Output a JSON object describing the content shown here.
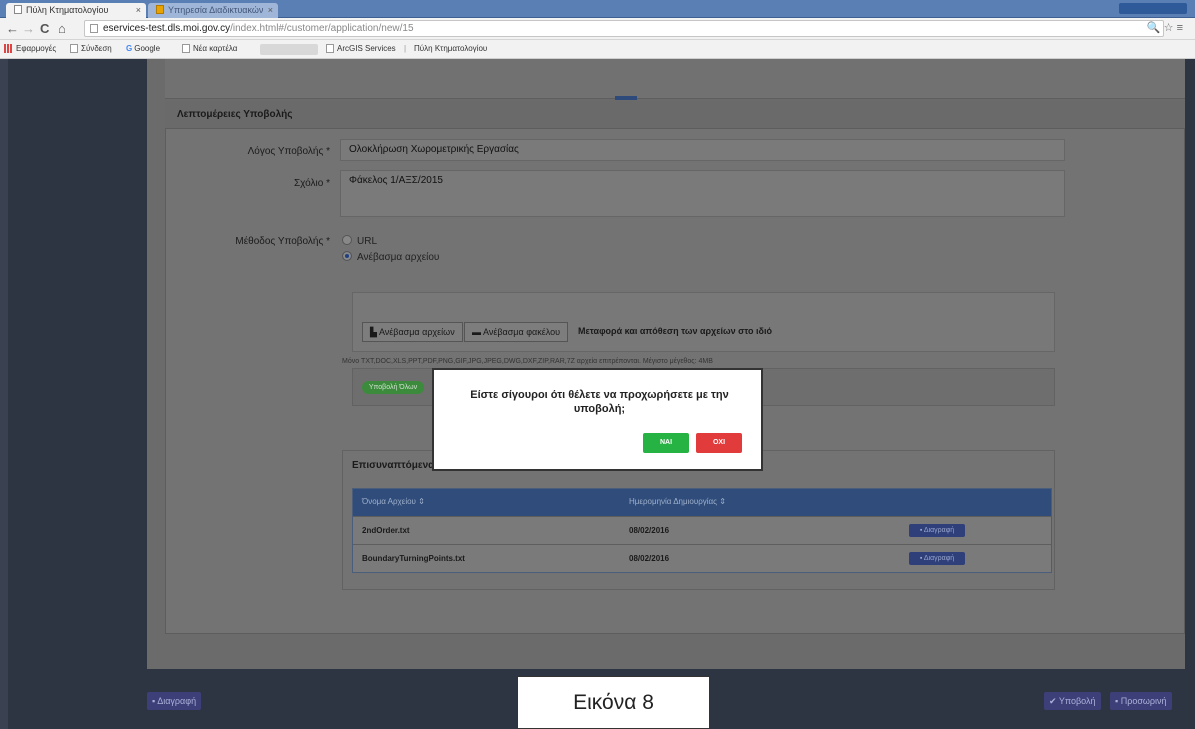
{
  "browser": {
    "tabs": [
      {
        "label": "Πύλη Κτηματολογίου",
        "active": true
      },
      {
        "label": "Υπηρεσία Διαδικτυακών",
        "active": false
      }
    ],
    "close_glyph": "×",
    "nav": {
      "back": "←",
      "forward": "→",
      "reload": "C",
      "home": "⌂"
    },
    "url_host": "eservices-test.dls.moi.gov.cy",
    "url_path": "/index.html#/customer/application/new/15",
    "url_right_icons": "🔍 ☆ ≡",
    "bookmarks": [
      "Εφαρμογές",
      "Σύνδεση",
      "Google",
      "Νέα καρτέλα",
      "ArcGIS Services",
      "Πύλη Κτηματολογίου"
    ],
    "bookmark_separator": "|"
  },
  "form": {
    "panel_title": "Λεπτομέρειες Υποβολής",
    "reason_label": "Λόγος Υποβολής",
    "reason_value": "Ολοκλήρωση Χωρομετρικής Εργασίας",
    "comment_label": "Σχόλιο",
    "comment_value": "Φάκελος 1/ΑΞΣ/2015",
    "method_label": "Μέθοδος Υποβολής",
    "required_mark": "*",
    "method_options": [
      "URL",
      "Ανέβασμα αρχείου"
    ],
    "upload_file_btn": "Ανέβασμα αρχείων",
    "upload_folder_btn": "Ανέβασμα φακέλου",
    "upload_hint": "Μεταφορά και απόθεση των αρχείων στο ιδιό",
    "allowed_types": "Μόνο TXT,DOC,XLS,PPT,PDF,PNG,GIF,JPG,JPEG,DWG,DXF,ZIP,RAR,7Z αρχεία επιτρέπονται. Μέγιστο μέγεθος: 4MB",
    "green_btn": "Υποβολή Όλων",
    "uploaded_title": "Επισυναπτόμενα",
    "table_headers": [
      "Όνομα Αρχείου ⇕",
      "Ημερομηνία Δημιουργίας ⇕"
    ],
    "rows": [
      {
        "name": "2ndOrder.txt",
        "date": "08/02/2016",
        "action": "Διαγραφή"
      },
      {
        "name": "BoundaryTurningPoints.txt",
        "date": "08/02/2016",
        "action": "Διαγραφή"
      }
    ]
  },
  "footer": {
    "delete_btn": "Διαγραφή",
    "submit_btn": "✔ Υποβολή",
    "save_btn": "Προσωρινή"
  },
  "modal": {
    "message": "Είστε σίγουροι ότι θέλετε να προχωρήσετε με την υποβολή;",
    "yes_label": "ΝΑΙ",
    "no_label": "ΟΧΙ"
  },
  "caption": "Εικόνα 8"
}
